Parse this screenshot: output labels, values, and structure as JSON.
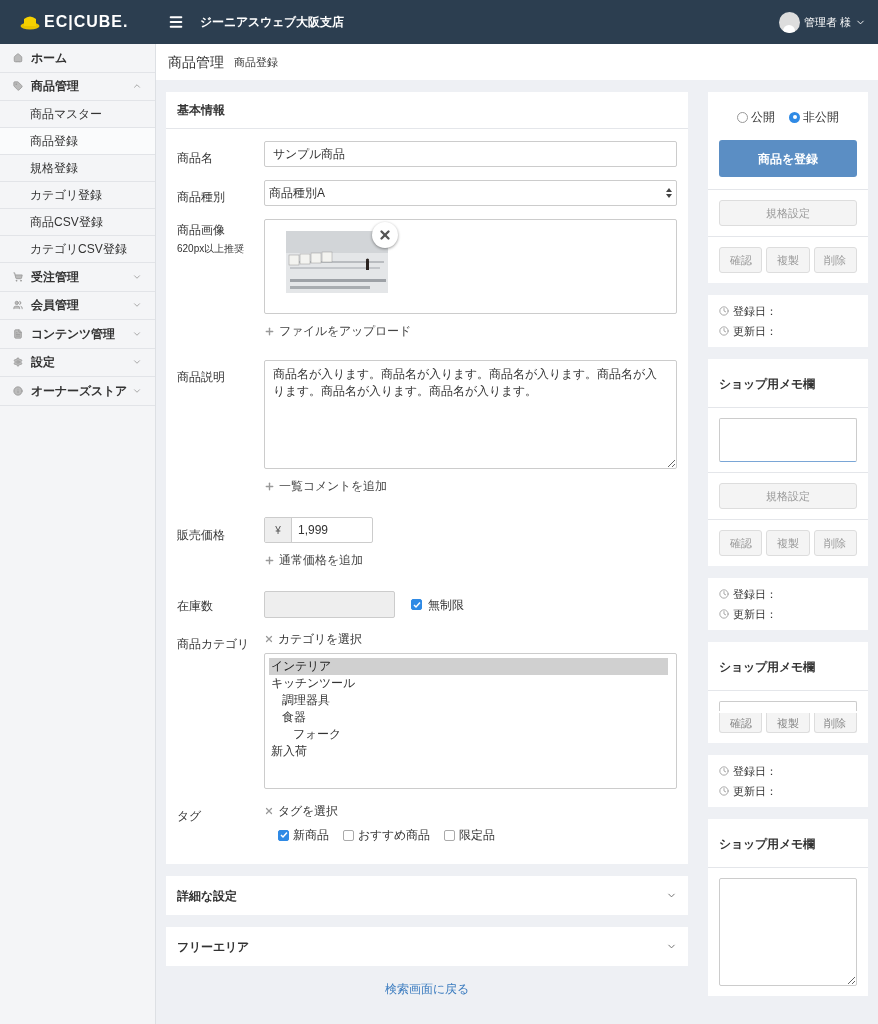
{
  "header": {
    "logo_text": "EC|CUBE.",
    "shop_name": "ジーニアスウェブ大阪支店",
    "user": "管理者 様"
  },
  "sidebar": {
    "items": [
      {
        "label": "ホーム"
      },
      {
        "label": "商品管理",
        "expanded": true,
        "children": [
          {
            "label": "商品マスター",
            "selected": false
          },
          {
            "label": "商品登録",
            "selected": true
          },
          {
            "label": "規格登録",
            "selected": false
          },
          {
            "label": "カテゴリ登録",
            "selected": false
          },
          {
            "label": "商品CSV登録",
            "selected": false
          },
          {
            "label": "カテゴリCSV登録",
            "selected": false
          }
        ]
      },
      {
        "label": "受注管理",
        "expanded": false
      },
      {
        "label": "会員管理",
        "expanded": false
      },
      {
        "label": "コンテンツ管理",
        "expanded": false
      },
      {
        "label": "設定",
        "expanded": false
      },
      {
        "label": "オーナーズストア",
        "expanded": false
      }
    ]
  },
  "page_header": {
    "title": "商品管理",
    "subtitle": "商品登録"
  },
  "basic_info": {
    "title": "基本情報",
    "name": {
      "label": "商品名",
      "value": "サンプル商品"
    },
    "type": {
      "label": "商品種別",
      "value": "商品種別A"
    },
    "image": {
      "label": "商品画像",
      "note": "620px以上推奨",
      "upload": "ファイルをアップロード"
    },
    "description": {
      "label": "商品説明",
      "value": "商品名が入ります。商品名が入ります。商品名が入ります。商品名が入ります。商品名が入ります。商品名が入ります。",
      "add": "一覧コメントを追加"
    },
    "price": {
      "label": "販売価格",
      "currency": "¥",
      "value": "1,999",
      "add": "通常価格を追加"
    },
    "stock": {
      "label": "在庫数",
      "unlimited": {
        "label": "無制限",
        "checked": true
      }
    },
    "category": {
      "label": "商品カテゴリ",
      "select": "カテゴリを選択",
      "options": [
        {
          "label": "インテリア",
          "selected": true
        },
        {
          "label": "キッチンツール",
          "selected": false,
          "children": [
            {
              "label": "調理器具",
              "selected": false
            },
            {
              "label": "食器",
              "selected": false,
              "children": [
                {
                  "label": "フォーク",
                  "selected": false
                }
              ]
            }
          ]
        },
        {
          "label": "新入荷",
          "selected": false
        }
      ]
    },
    "tags": {
      "label": "タグ",
      "select": "タグを選択",
      "options": [
        {
          "label": "新商品",
          "checked": true
        },
        {
          "label": "おすすめ商品",
          "checked": false
        },
        {
          "label": "限定品",
          "checked": false
        }
      ]
    }
  },
  "collapsed_sections": [
    {
      "title": "詳細な設定",
      "expanded": false
    },
    {
      "title": "フリーエリア",
      "expanded": false
    }
  ],
  "back_link": "検索画面に戻る",
  "side_panels": [
    {
      "sections": [
        {
          "kind": "publish",
          "options": [
            {
              "label": "公開",
              "selected": false
            },
            {
              "label": "非公開",
              "selected": true
            }
          ],
          "button": "商品を登録"
        },
        {
          "kind": "buttons",
          "buttons": [
            {
              "label": "規格設定",
              "disabled": true
            }
          ]
        },
        {
          "kind": "buttons",
          "buttons": [
            {
              "label": "確認",
              "disabled": true
            },
            {
              "label": "複製",
              "disabled": true
            },
            {
              "label": "削除",
              "disabled": true
            }
          ]
        }
      ]
    },
    {
      "sections": [
        {
          "kind": "dates",
          "rows": [
            "登録日：",
            "更新日："
          ]
        }
      ]
    },
    {
      "sections": [
        {
          "kind": "title",
          "title": "ショップ用メモ欄"
        },
        {
          "kind": "note_field"
        },
        {
          "kind": "buttons",
          "buttons": [
            {
              "label": "規格設定",
              "disabled": true
            }
          ]
        },
        {
          "kind": "buttons",
          "buttons": [
            {
              "label": "確認",
              "disabled": true
            },
            {
              "label": "複製",
              "disabled": true
            },
            {
              "label": "削除",
              "disabled": true
            }
          ]
        }
      ]
    },
    {
      "sections": [
        {
          "kind": "dates",
          "rows": [
            "登録日：",
            "更新日："
          ]
        }
      ]
    },
    {
      "sections": [
        {
          "kind": "title",
          "title": "ショップ用メモ欄"
        },
        {
          "kind": "note_over_buttons",
          "buttons": [
            {
              "label": "確認",
              "disabled": true
            },
            {
              "label": "複製",
              "disabled": true
            },
            {
              "label": "削除",
              "disabled": true
            }
          ]
        }
      ]
    },
    {
      "sections": [
        {
          "kind": "dates",
          "rows": [
            "登録日：",
            "更新日："
          ]
        }
      ]
    },
    {
      "sections": [
        {
          "kind": "title",
          "title": "ショップ用メモ欄"
        },
        {
          "kind": "note_area"
        }
      ]
    }
  ]
}
